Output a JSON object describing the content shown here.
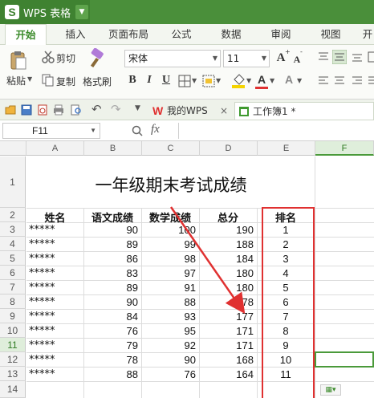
{
  "app": {
    "name": "WPS 表格",
    "logo": "S"
  },
  "tabs": [
    "开始",
    "插入",
    "页面布局",
    "公式",
    "数据",
    "审阅",
    "视图",
    "开"
  ],
  "ribbon": {
    "paste": "粘贴",
    "cut": "剪切",
    "copy": "复制",
    "format_painter": "格式刷",
    "font_name": "宋体",
    "font_size": "11",
    "bold": "B",
    "italic": "I",
    "underline": "U",
    "grow_font": "A",
    "shrink_font": "A"
  },
  "doc_tabs": {
    "home": "我的WPS",
    "workbook": "工作簿1 *"
  },
  "formula_bar": {
    "name_box": "F11",
    "fx": "fx"
  },
  "columns": [
    "A",
    "B",
    "C",
    "D",
    "E",
    "F"
  ],
  "rows": [
    "1",
    "2",
    "3",
    "4",
    "5",
    "6",
    "7",
    "8",
    "9",
    "10",
    "11",
    "12",
    "13",
    "14"
  ],
  "sheet": {
    "title": "一年级期末考试成绩",
    "headers": [
      "姓名",
      "语文成绩",
      "数学成绩",
      "总分",
      "排名"
    ],
    "data": [
      [
        "*****",
        "90",
        "100",
        "190",
        "1"
      ],
      [
        "*****",
        "89",
        "99",
        "188",
        "2"
      ],
      [
        "*****",
        "86",
        "98",
        "184",
        "3"
      ],
      [
        "*****",
        "83",
        "97",
        "180",
        "4"
      ],
      [
        "*****",
        "89",
        "91",
        "180",
        "5"
      ],
      [
        "*****",
        "90",
        "88",
        "178",
        "6"
      ],
      [
        "*****",
        "84",
        "93",
        "177",
        "7"
      ],
      [
        "*****",
        "76",
        "95",
        "171",
        "8"
      ],
      [
        "*****",
        "79",
        "92",
        "171",
        "9"
      ],
      [
        "*****",
        "78",
        "90",
        "168",
        "10"
      ],
      [
        "*****",
        "88",
        "76",
        "164",
        "11"
      ]
    ]
  },
  "colors": {
    "brand_green": "#4a8f3a",
    "highlight_red": "#e03131",
    "selection_green": "#4a9a3a"
  }
}
